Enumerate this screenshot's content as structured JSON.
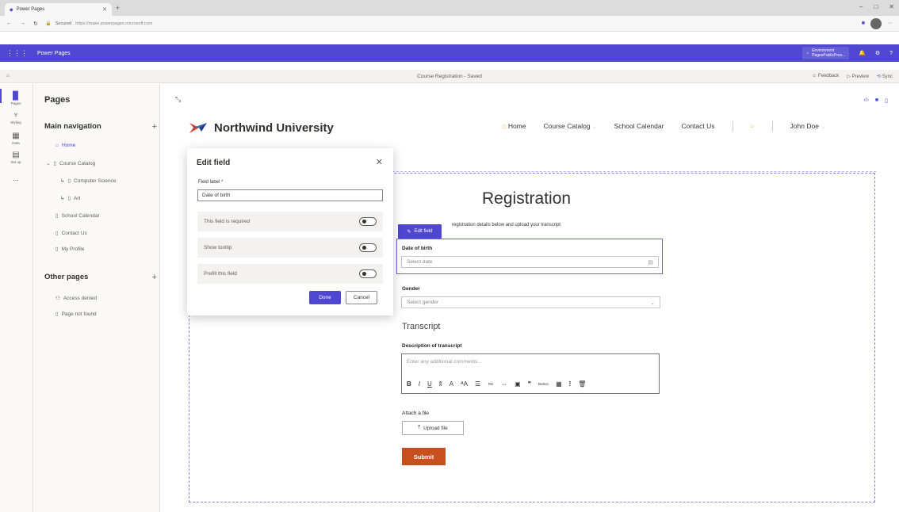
{
  "browser": {
    "tab_title": "Power Pages",
    "security": "Secured",
    "url": "https://make.powerpages.microsoft.com"
  },
  "app": {
    "name": "Power Pages",
    "environment_label": "Environment",
    "environment_name": "PagesPublicPrev..."
  },
  "commandbar": {
    "status": "Course Registration - Saved",
    "feedback": "Feedback",
    "preview": "Preview",
    "sync": "Sync"
  },
  "rail": {
    "items": [
      {
        "label": "Pages",
        "icon": "pages-icon"
      },
      {
        "label": "Styling",
        "icon": "styling-icon"
      },
      {
        "label": "Data",
        "icon": "data-icon"
      },
      {
        "label": "Set up",
        "icon": "setup-icon"
      }
    ],
    "more": "..."
  },
  "panel": {
    "title": "Pages",
    "main_nav_title": "Main navigation",
    "main_nav_items": [
      {
        "label": "Home"
      },
      {
        "label": "Course Catalog"
      },
      {
        "label": "Computer Science"
      },
      {
        "label": "Art"
      },
      {
        "label": "School Calendar"
      },
      {
        "label": "Contact Us"
      },
      {
        "label": "My Profile"
      }
    ],
    "other_title": "Other pages",
    "other_items": [
      {
        "label": "Access denied"
      },
      {
        "label": "Page not found"
      }
    ]
  },
  "site": {
    "logo_text": "Northwind University",
    "nav": [
      "Home",
      "Course Catalog",
      "School Calendar",
      "Contact Us"
    ],
    "user": "John Doe"
  },
  "form": {
    "title": "Registration",
    "subtitle": "registration details below and upload your transcript",
    "edit_chip": "Edit field",
    "dob_label": "Date of birth",
    "dob_placeholder": "Select date",
    "gender_label": "Gender",
    "gender_placeholder": "Select gender",
    "transcript_heading": "Transcript",
    "desc_label": "Description of transcript",
    "desc_placeholder": "Enter any additional comments...",
    "attach_label": "Attach a file",
    "upload_label": "Upload file",
    "submit_label": "Submit",
    "rte_button": "Button"
  },
  "dialog": {
    "title": "Edit field",
    "field_label": "Field label *",
    "field_value": "Date of birth",
    "toggles": [
      {
        "label": "This field is required"
      },
      {
        "label": "Show tooltip"
      },
      {
        "label": "Prefill this field"
      }
    ],
    "done": "Done",
    "cancel": "Cancel"
  },
  "colors": {
    "brand": "#4f47d0",
    "submit": "#c8501f"
  }
}
